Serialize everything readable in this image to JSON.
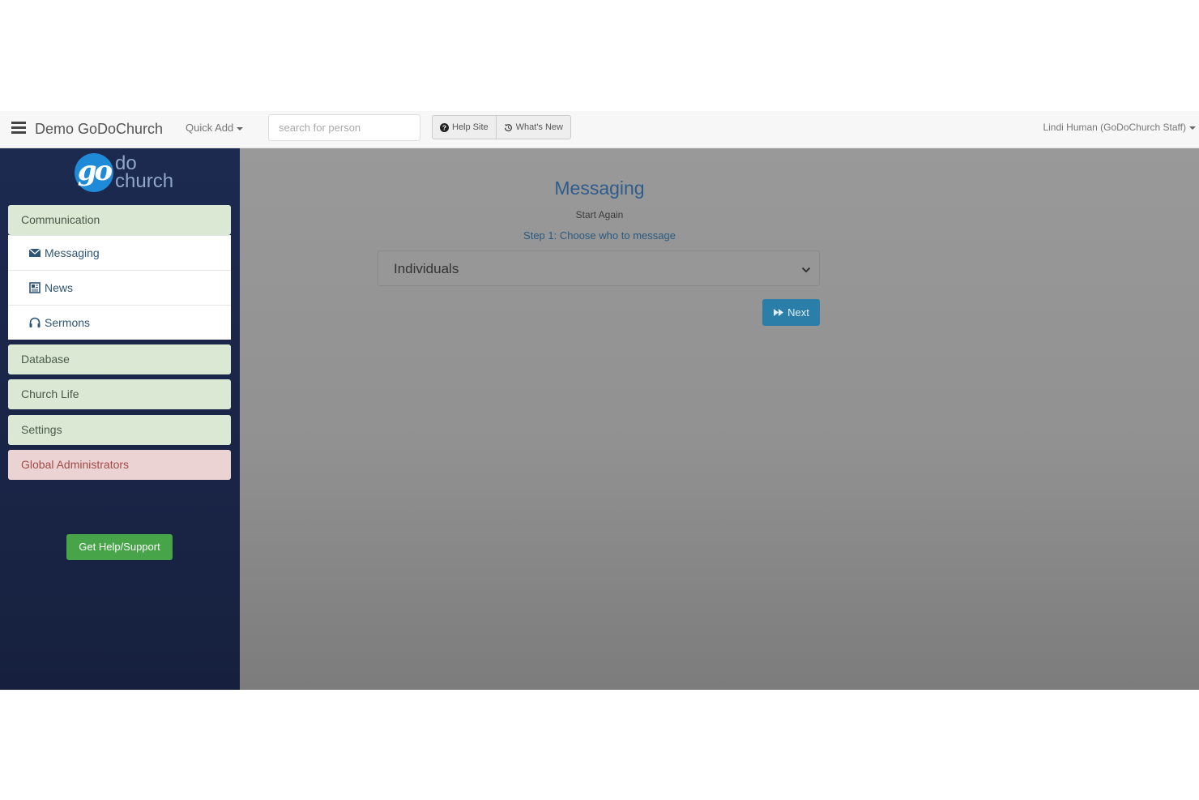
{
  "topbar": {
    "brand": "Demo GoDoChurch",
    "quick_add": "Quick Add",
    "search_placeholder": "search for person",
    "help_site": "Help Site",
    "whats_new": "What's New",
    "user": "Lindi Human (GoDoChurch Staff)"
  },
  "sidebar": {
    "logo_text_top": "do",
    "logo_text_bottom": "church",
    "communication": "Communication",
    "messaging": "Messaging",
    "news": "News",
    "sermons": "Sermons",
    "database": "Database",
    "church_life": "Church Life",
    "settings": "Settings",
    "global_admins": "Global Administrators",
    "help_button": "Get Help/Support"
  },
  "main": {
    "title": "Messaging",
    "start_again": "Start Again",
    "step": "Step 1: Choose who to message",
    "recipient_select": "Individuals",
    "next_button": "Next"
  },
  "icons": [
    "menu-icon",
    "question-circle-icon",
    "history-icon",
    "envelope-icon",
    "newspaper-icon",
    "headphones-icon",
    "chevron-down-icon",
    "fast-forward-icon"
  ],
  "colors": {
    "sidebar_bg": "#1c2a50",
    "menu_green": "#dbe9d4",
    "menu_red": "#ecd3d3",
    "help_green": "#47a448",
    "next_blue": "#2a7ea8",
    "title_blue": "#2f5c8c"
  }
}
